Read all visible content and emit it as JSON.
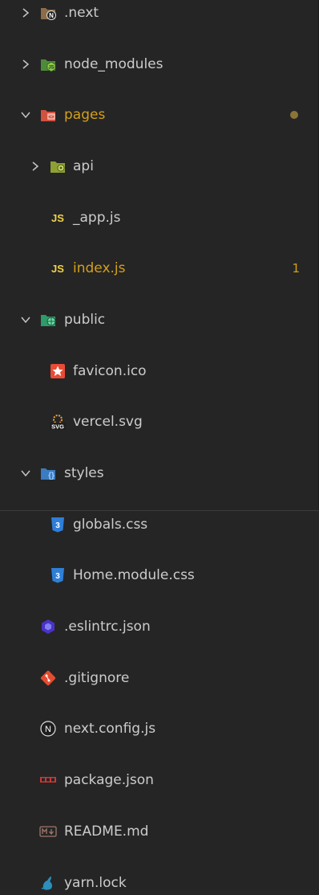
{
  "explorer": {
    "items": [
      {
        "label": ".next",
        "type": "folder",
        "expanded": false
      },
      {
        "label": "node_modules",
        "type": "folder",
        "expanded": false
      },
      {
        "label": "pages",
        "type": "folder",
        "expanded": true,
        "modified": true
      },
      {
        "label": "api",
        "type": "folder",
        "expanded": false
      },
      {
        "label": "_app.js",
        "type": "file"
      },
      {
        "label": "index.js",
        "type": "file",
        "modified": true,
        "problems": "1"
      },
      {
        "label": "public",
        "type": "folder",
        "expanded": true
      },
      {
        "label": "favicon.ico",
        "type": "file"
      },
      {
        "label": "vercel.svg",
        "type": "file"
      },
      {
        "label": "styles",
        "type": "folder",
        "expanded": true
      },
      {
        "label": "globals.css",
        "type": "file"
      },
      {
        "label": "Home.module.css",
        "type": "file"
      },
      {
        "label": ".eslintrc.json",
        "type": "file"
      },
      {
        "label": ".gitignore",
        "type": "file"
      },
      {
        "label": "next.config.js",
        "type": "file"
      },
      {
        "label": "package.json",
        "type": "file"
      },
      {
        "label": "README.md",
        "type": "file"
      },
      {
        "label": "yarn.lock",
        "type": "file"
      }
    ]
  },
  "colors": {
    "background": "#252526",
    "text": "#cccccc",
    "modified": "#d4a017"
  },
  "icons": {
    "next_folder": "next-folder-icon",
    "node_modules_folder": "node-folder-icon",
    "pages_folder": "pages-folder-icon",
    "api_folder": "api-folder-icon",
    "js_file": "js-file-icon",
    "public_folder": "public-folder-icon",
    "favicon": "favicon-star-icon",
    "svg_file": "svg-file-icon",
    "styles_folder": "styles-folder-icon",
    "css_file": "css-file-icon",
    "eslint": "eslint-icon",
    "git": "git-icon",
    "next": "next-icon",
    "npm": "npm-icon",
    "markdown": "markdown-icon",
    "yarn": "yarn-icon"
  }
}
